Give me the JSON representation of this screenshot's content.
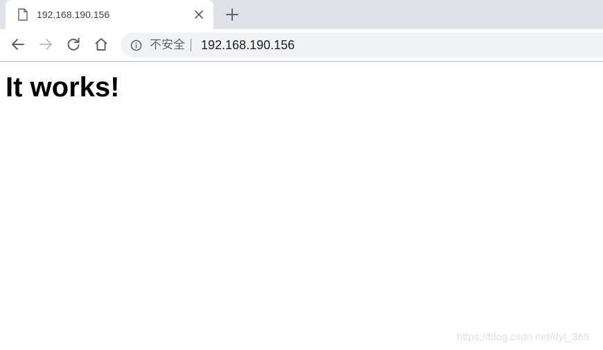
{
  "tab": {
    "title": "192.168.190.156",
    "favicon": "page-icon",
    "close": "close-icon"
  },
  "new_tab": "plus-icon",
  "toolbar": {
    "back": "arrow-left-icon",
    "forward": "arrow-right-icon",
    "reload": "reload-icon",
    "home": "home-icon"
  },
  "omnibox": {
    "security_icon": "info-icon",
    "security_label": "不安全",
    "url": "192.168.190.156"
  },
  "page": {
    "heading": "It works!"
  },
  "watermark": "https://blog.csdn.net/dyl_369",
  "colors": {
    "tabstrip_bg": "#dee1e6",
    "omnibox_bg": "#f1f3f4",
    "icon_active": "#5f6368",
    "icon_disabled": "#bdc1c6"
  }
}
